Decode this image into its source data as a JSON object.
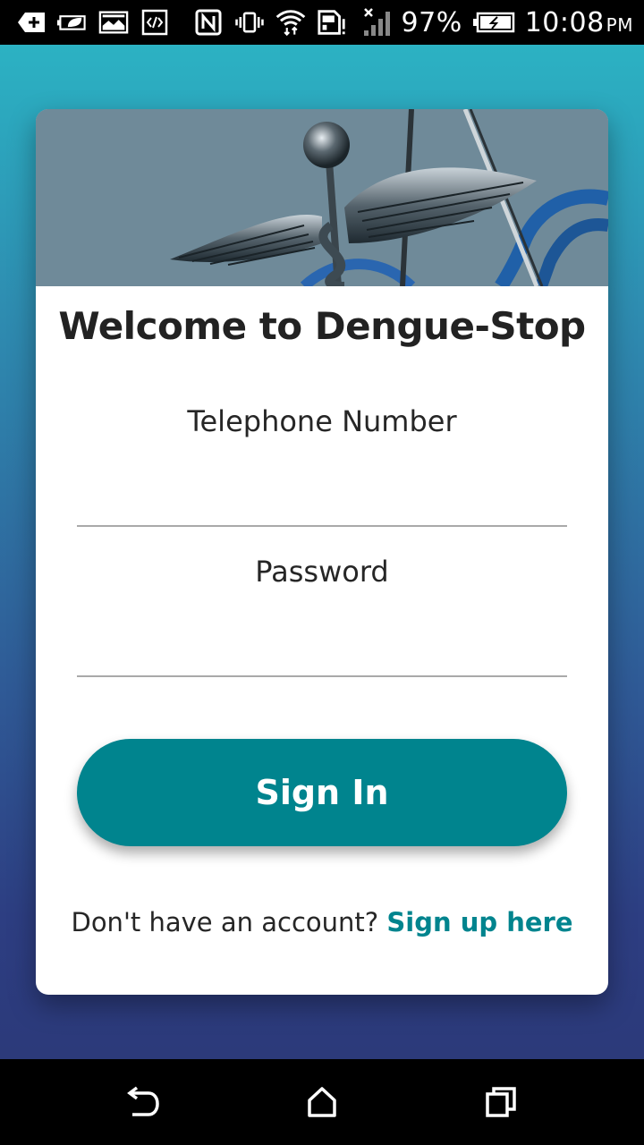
{
  "status_bar": {
    "battery_percent": "97%",
    "time": "10:08",
    "ampm": "PM",
    "icons": [
      "add-box-icon",
      "leaf-battery-icon",
      "gallery-icon",
      "code-icon",
      "nfc-icon",
      "vibrate-icon",
      "wifi-icon",
      "sd-card-alert-icon",
      "no-signal-icon",
      "battery-charging-icon"
    ]
  },
  "card": {
    "banner_image": "caduceus-stethoscope-banner",
    "title": "Welcome to Dengue-Stop"
  },
  "form": {
    "phone_label": "Telephone Number",
    "phone_value": "",
    "password_label": "Password",
    "password_value": "",
    "signin_label": "Sign In"
  },
  "signup": {
    "prompt": "Don't have an account? ",
    "link": "Sign up here"
  },
  "nav_bar": {
    "icons": [
      "back-icon",
      "home-icon",
      "recents-icon"
    ]
  },
  "colors": {
    "accent": "#00848e",
    "gradient_top": "#2bb8c6",
    "gradient_bottom": "#2b3775"
  }
}
